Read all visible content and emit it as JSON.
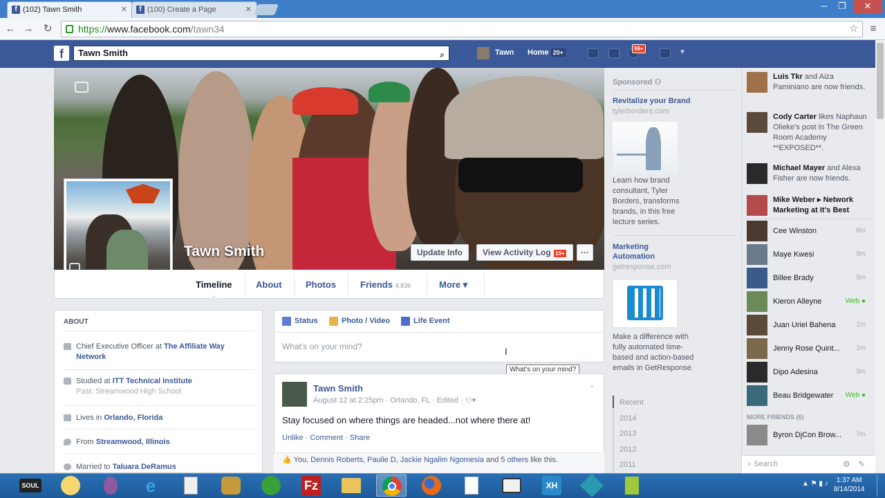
{
  "browser": {
    "tabs": [
      {
        "title": "(102) Tawn Smith",
        "active": true
      },
      {
        "title": "(100) Create a Page",
        "active": false
      }
    ],
    "url": {
      "scheme": "https://",
      "domain": "www.facebook.com",
      "path": "/tawn34"
    }
  },
  "fbbar": {
    "search_value": "Tawn Smith",
    "user_name": "Tawn",
    "home_label": "Home",
    "home_count": "20+",
    "notif_count": "99+"
  },
  "profile": {
    "name": "Tawn Smith",
    "update_info": "Update Info",
    "activity_log": "View Activity Log",
    "activity_count": "10+",
    "more_dots": "···"
  },
  "tabs": [
    {
      "label": "Timeline"
    },
    {
      "label": "About"
    },
    {
      "label": "Photos"
    },
    {
      "label": "Friends",
      "count": "4,836"
    },
    {
      "label": "More ▾"
    }
  ],
  "about": {
    "header": "ABOUT",
    "rows": [
      {
        "prefix": "Chief Executive Officer at ",
        "link": "The Affiliate Way Network"
      },
      {
        "prefix": "Studied at ",
        "link": "ITT Technical Institute",
        "sub": "Past: Streamwood High School"
      },
      {
        "prefix": "Lives in ",
        "link": "Orlando, Florida"
      },
      {
        "prefix": "From ",
        "link": "Streamwood, Illinois"
      },
      {
        "prefix": "Married to ",
        "link": "Taluara DeRamus"
      }
    ]
  },
  "composer": {
    "status": "Status",
    "photo": "Photo / Video",
    "life": "Life Event",
    "placeholder": "What's on your mind?",
    "tooltip": "What's on your mind?"
  },
  "post": {
    "author": "Tawn Smith",
    "meta": "August 12 at 2:25pm · Orlando, FL · Edited · ",
    "text": "Stay focused on where things are headed...not where there at!",
    "actions": "Unlike · Comment · Share",
    "likes_prefix": "You, ",
    "likes_names": "Dennis Roberts, Paulie D, Jackie Ngalim Ngomesia",
    "likes_and": " and ",
    "likes_others": "5 others",
    "likes_suffix": " like this."
  },
  "ads": {
    "sponsored": "Sponsored",
    "ad1": {
      "title": "Revitalize your Brand",
      "url": "tylerborders.com",
      "text": "Learn how brand consultant, Tyler Borders, transforms brands, in this free lecture series."
    },
    "ad2": {
      "title": "Marketing Automation",
      "url": "getresponse.com",
      "text": "Make a difference with fully automated time-based and action-based emails in GetResponse."
    },
    "years": [
      "Recent",
      "2014",
      "2013",
      "2012",
      "2011"
    ]
  },
  "ticker": [
    {
      "bold": "Luis Tkr",
      "rest": " and Aiza Paminiano are now friends."
    },
    {
      "bold": "Cody Carter",
      "rest": " likes Naphaun Olieke's post in The Green Room Academy **EXPOSED**."
    },
    {
      "bold": "Michael Mayer",
      "rest": " and Alexa Fisher are now friends."
    },
    {
      "bold": "Mike Weber",
      "rest": " ▸ Network Marketing at It's Best"
    }
  ],
  "chat": {
    "contacts": [
      {
        "name": "Cee Winston",
        "status": "8m"
      },
      {
        "name": "Maye Kwesi",
        "status": "9m"
      },
      {
        "name": "Billee Brady",
        "status": "9m"
      },
      {
        "name": "Kieron Alleyne",
        "status": "Web"
      },
      {
        "name": "Juan Uriel Bahena",
        "status": "1m"
      },
      {
        "name": "Jenny Rose Quint...",
        "status": "1m"
      },
      {
        "name": "Dipo Adesina",
        "status": "3m"
      },
      {
        "name": "Beau Bridgewater",
        "status": "Web"
      }
    ],
    "more_header": "MORE FRIENDS (6)",
    "more": [
      {
        "name": "Byron DjCon Brow...",
        "status": "7m"
      }
    ],
    "search_placeholder": "Search"
  },
  "taskbar": {
    "time": "1:37 AM",
    "date": "8/14/2014"
  },
  "colors": {
    "fb_blue": "#3b5998",
    "taskbar": "#1d5a9a",
    "online": "#42b72a"
  }
}
